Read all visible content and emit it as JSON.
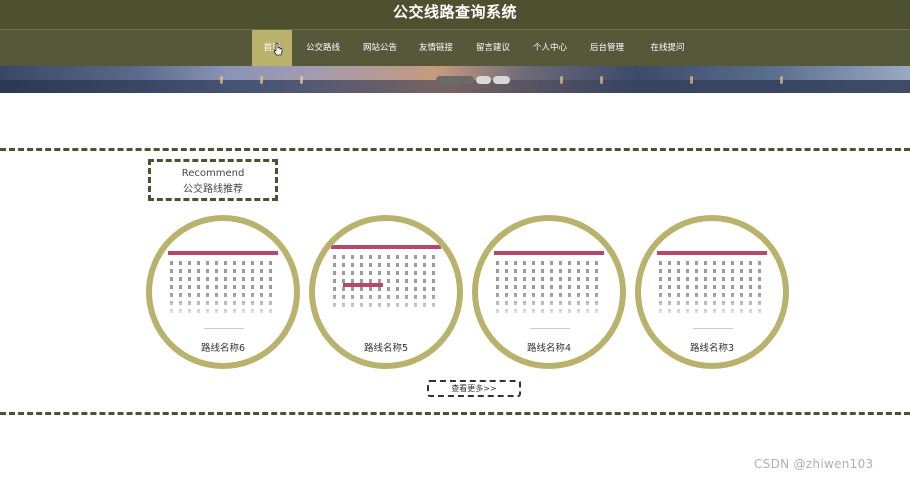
{
  "header": {
    "title": "公交线路查询系统"
  },
  "nav": {
    "items": [
      {
        "label": "首页",
        "active": true
      },
      {
        "label": "公交路线",
        "active": false
      },
      {
        "label": "网站公告",
        "active": false
      },
      {
        "label": "友情链接",
        "active": false
      },
      {
        "label": "留言建议",
        "active": false
      },
      {
        "label": "个人中心",
        "active": false
      },
      {
        "label": "后台管理",
        "active": false
      },
      {
        "label": "在线提问",
        "active": false
      }
    ]
  },
  "section": {
    "recommend_en": "Recommend",
    "recommend_cn": "公交路线推荐"
  },
  "cards": [
    {
      "title": "路线名称6"
    },
    {
      "title": "路线名称5"
    },
    {
      "title": "路线名称4"
    },
    {
      "title": "路线名称3"
    }
  ],
  "more_button": {
    "label": "查看更多>>"
  },
  "watermark": "CSDN @zhiwen103",
  "colors": {
    "header_bg": "#4e5130",
    "nav_bg": "#56583a",
    "accent": "#b8b26c",
    "route_strip": "#b5476a"
  }
}
